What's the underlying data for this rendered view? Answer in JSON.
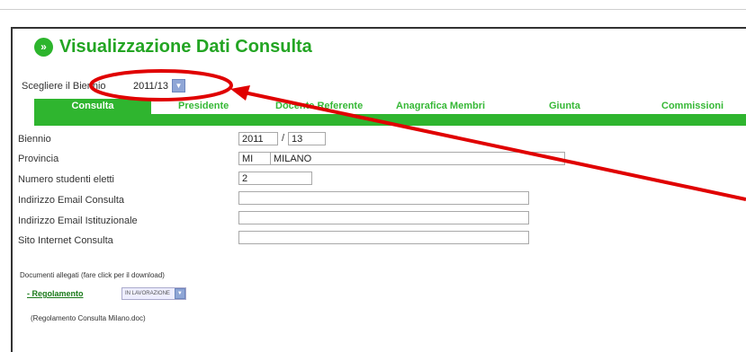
{
  "page": {
    "title": "Visualizzazione Dati Consulta",
    "biennio_label": "Scegliere il Biennio",
    "biennio_value": "2011/13"
  },
  "tabs": [
    {
      "label": "Consulta",
      "active": true
    },
    {
      "label": "Presidente",
      "active": false
    },
    {
      "label": "Docente Referente",
      "active": false
    },
    {
      "label": "Anagrafica Membri",
      "active": false
    },
    {
      "label": "Giunta",
      "active": false
    },
    {
      "label": "Commissioni",
      "active": false
    }
  ],
  "form": {
    "biennio": {
      "label": "Biennio",
      "from": "2011",
      "to": "13"
    },
    "provincia": {
      "label": "Provincia",
      "code": "MI",
      "name": "MILANO"
    },
    "studenti": {
      "label": "Numero studenti eletti",
      "value": "2"
    },
    "email_consulta": {
      "label": "Indirizzo Email Consulta",
      "value": ""
    },
    "email_istituzionale": {
      "label": "Indirizzo Email Istituzionale",
      "value": ""
    },
    "sito": {
      "label": "Sito Internet Consulta",
      "value": ""
    }
  },
  "documents": {
    "header": "Documenti allegati (fare click per il download)",
    "items": [
      {
        "link": "- Regolamento",
        "state": "IN LAVORAZIONE",
        "file": "(Regolamento Consulta Milano.doc)"
      }
    ]
  },
  "colors": {
    "green": "#2fb52f",
    "title_green": "#23a523",
    "annotation_red": "#e00000"
  }
}
